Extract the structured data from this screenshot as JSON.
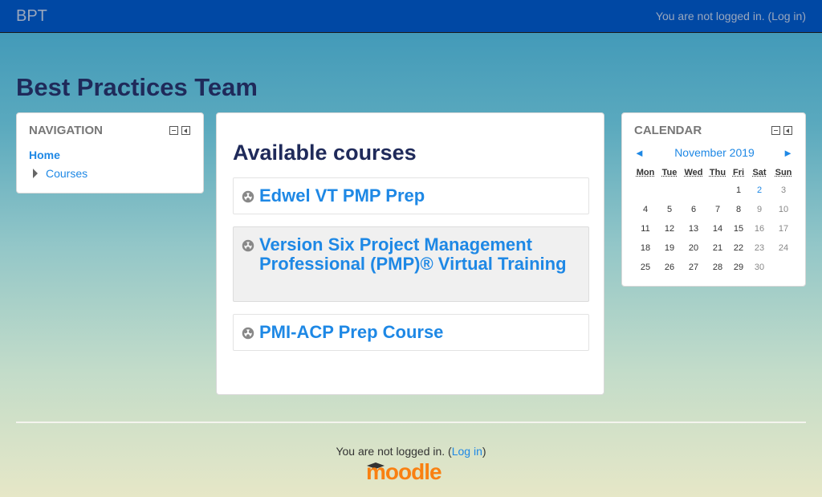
{
  "navbar": {
    "brand": "BPT",
    "login_prefix": "You are not logged in. (",
    "login_link": "Log in",
    "login_suffix": ")"
  },
  "site_title": "Best Practices Team",
  "navigation": {
    "title": "NAVIGATION",
    "home": "Home",
    "courses": "Courses"
  },
  "main": {
    "heading": "Available courses",
    "courses": [
      {
        "name": "Edwel VT PMP Prep"
      },
      {
        "name": "Version Six Project Management Professional (PMP)® Virtual Training"
      },
      {
        "name": "PMI-ACP Prep Course"
      }
    ]
  },
  "calendar": {
    "title": "CALENDAR",
    "prev": "◄",
    "next": "►",
    "month": "November 2019",
    "days": [
      "Mon",
      "Tue",
      "Wed",
      "Thu",
      "Fri",
      "Sat",
      "Sun"
    ],
    "weeks": [
      [
        "",
        "",
        "",
        "",
        "1",
        "2",
        "3"
      ],
      [
        "4",
        "5",
        "6",
        "7",
        "8",
        "9",
        "10"
      ],
      [
        "11",
        "12",
        "13",
        "14",
        "15",
        "16",
        "17"
      ],
      [
        "18",
        "19",
        "20",
        "21",
        "22",
        "23",
        "24"
      ],
      [
        "25",
        "26",
        "27",
        "28",
        "29",
        "30",
        ""
      ]
    ]
  },
  "footer": {
    "login_prefix": "You are not logged in. (",
    "login_link": "Log in",
    "login_suffix": ")",
    "logo": "moodle"
  },
  "colors": {
    "navbar": "#0048a4",
    "link": "#1e88e5",
    "heading": "#1f2a5a",
    "moodle_orange": "#f98012"
  }
}
